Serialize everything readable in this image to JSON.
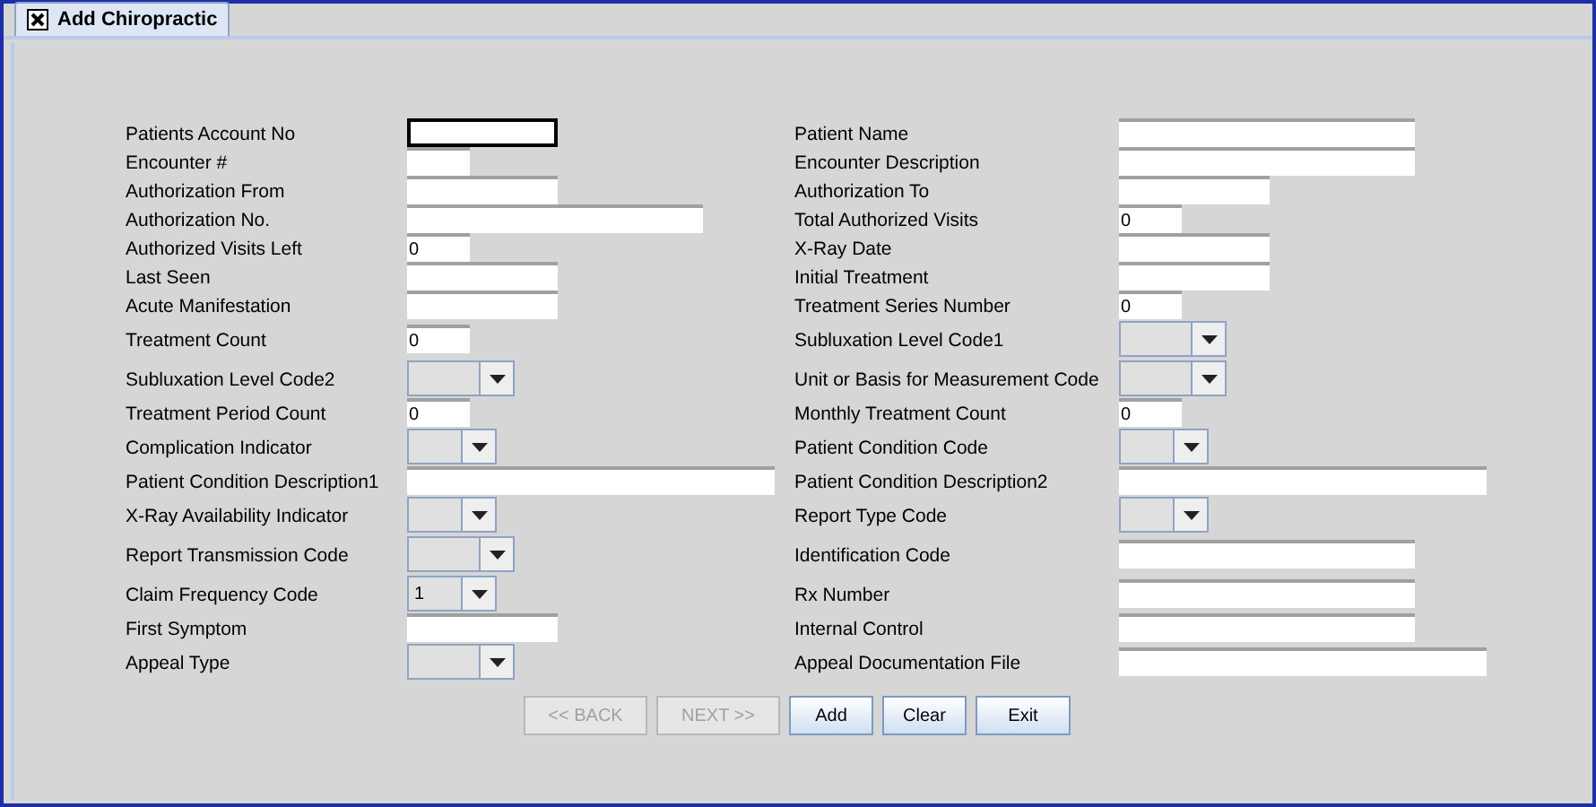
{
  "tab": {
    "title": "Add Chiropractic"
  },
  "rows": [
    {
      "left": {
        "label": "Patients Account No",
        "kind": "text",
        "focused": true
      },
      "right": {
        "label": "Patient Name",
        "kind": "text",
        "focused": false
      }
    },
    {
      "left": {
        "label": "Encounter #",
        "kind": "text",
        "focused": false
      },
      "right": {
        "label": "Encounter Description",
        "kind": "text",
        "focused": false
      }
    },
    {
      "left": {
        "label": "Authorization From",
        "kind": "text",
        "focused": false
      },
      "right": {
        "label": "Authorization To",
        "kind": "text",
        "focused": false
      }
    },
    {
      "left": {
        "label": "Authorization No.",
        "kind": "text",
        "focused": false
      },
      "right": {
        "label": "Total Authorized Visits",
        "kind": "text",
        "value": "0",
        "focused": false
      }
    },
    {
      "left": {
        "label": "Authorized Visits Left",
        "kind": "text",
        "value": "0",
        "focused": false
      },
      "right": {
        "label": "X-Ray Date",
        "kind": "text",
        "focused": false
      }
    },
    {
      "left": {
        "label": "Last Seen",
        "kind": "text",
        "focused": false
      },
      "right": {
        "label": "Initial Treatment",
        "kind": "text",
        "focused": false
      }
    },
    {
      "left": {
        "label": "Acute Manifestation",
        "kind": "text",
        "focused": false
      },
      "right": {
        "label": "Treatment Series Number",
        "kind": "text",
        "value": "0",
        "focused": false
      }
    },
    {
      "left": {
        "label": "Treatment Count",
        "kind": "text",
        "value": "0",
        "focused": false
      },
      "right": {
        "label": "Subluxation Level Code1",
        "kind": "combo"
      }
    },
    {
      "left": {
        "label": "Subluxation Level Code2",
        "kind": "combo"
      },
      "right": {
        "label": "Unit or Basis for Measurement Code",
        "kind": "combo"
      }
    },
    {
      "left": {
        "label": "Treatment Period Count",
        "kind": "text",
        "value": "0",
        "focused": false
      },
      "right": {
        "label": "Monthly Treatment Count",
        "kind": "text",
        "value": "0",
        "focused": false
      }
    },
    {
      "left": {
        "label": "Complication Indicator",
        "kind": "combo"
      },
      "right": {
        "label": "Patient Condition Code",
        "kind": "combo"
      }
    },
    {
      "left": {
        "label": "Patient Condition Description1",
        "kind": "text",
        "focused": false
      },
      "right": {
        "label": "Patient Condition Description2",
        "kind": "text",
        "focused": false
      }
    },
    {
      "left": {
        "label": "X-Ray Availability Indicator",
        "kind": "combo"
      },
      "right": {
        "label": "Report Type Code",
        "kind": "combo"
      }
    },
    {
      "left": {
        "label": "Report Transmission Code",
        "kind": "combo"
      },
      "right": {
        "label": "Identification Code",
        "kind": "text",
        "focused": false
      }
    },
    {
      "left": {
        "label": "Claim Frequency Code",
        "kind": "combo",
        "value": "1"
      },
      "right": {
        "label": "Rx Number",
        "kind": "text",
        "focused": false
      }
    },
    {
      "left": {
        "label": "First Symptom",
        "kind": "text",
        "focused": false
      },
      "right": {
        "label": "Internal Control",
        "kind": "text",
        "focused": false
      }
    },
    {
      "left": {
        "label": "Appeal Type",
        "kind": "combo"
      },
      "right": {
        "label": "Appeal Documentation File",
        "kind": "text",
        "focused": false
      }
    }
  ],
  "buttons": [
    {
      "label": "<< BACK",
      "disabled": true
    },
    {
      "label": "NEXT >>",
      "disabled": true
    },
    {
      "label": "Add",
      "disabled": false
    },
    {
      "label": "Clear",
      "disabled": false
    },
    {
      "label": "Exit",
      "disabled": false
    }
  ]
}
